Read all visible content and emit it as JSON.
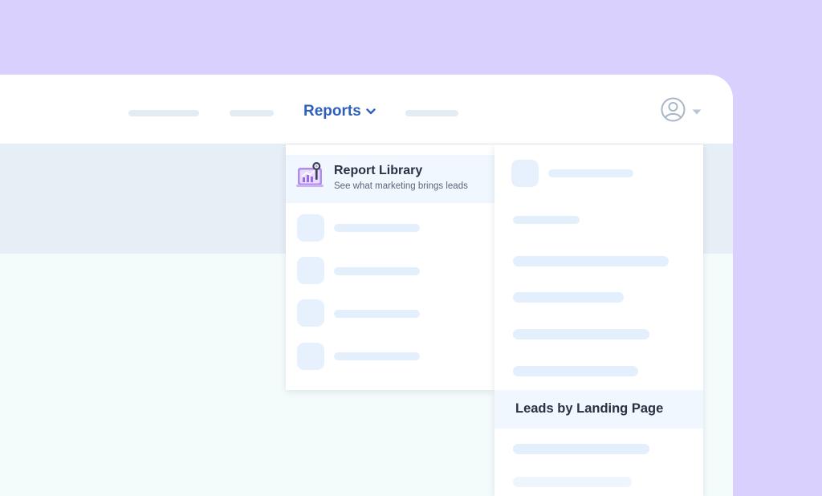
{
  "nav": {
    "reports_label": "Reports",
    "reports_icon": "chevron-down-icon",
    "account_icon": "user-circle-icon",
    "account_menu_icon": "caret-down-icon"
  },
  "reports_menu": {
    "library_title": "Report Library",
    "library_subtitle": "See what marketing brings leads",
    "library_icon": "report-library-icon"
  },
  "submenu": {
    "selected_label": "Leads by Landing Page"
  },
  "colors": {
    "accent": "#2f5fbd",
    "background": "#d9d0fd",
    "highlight": "#f0f7fe"
  }
}
